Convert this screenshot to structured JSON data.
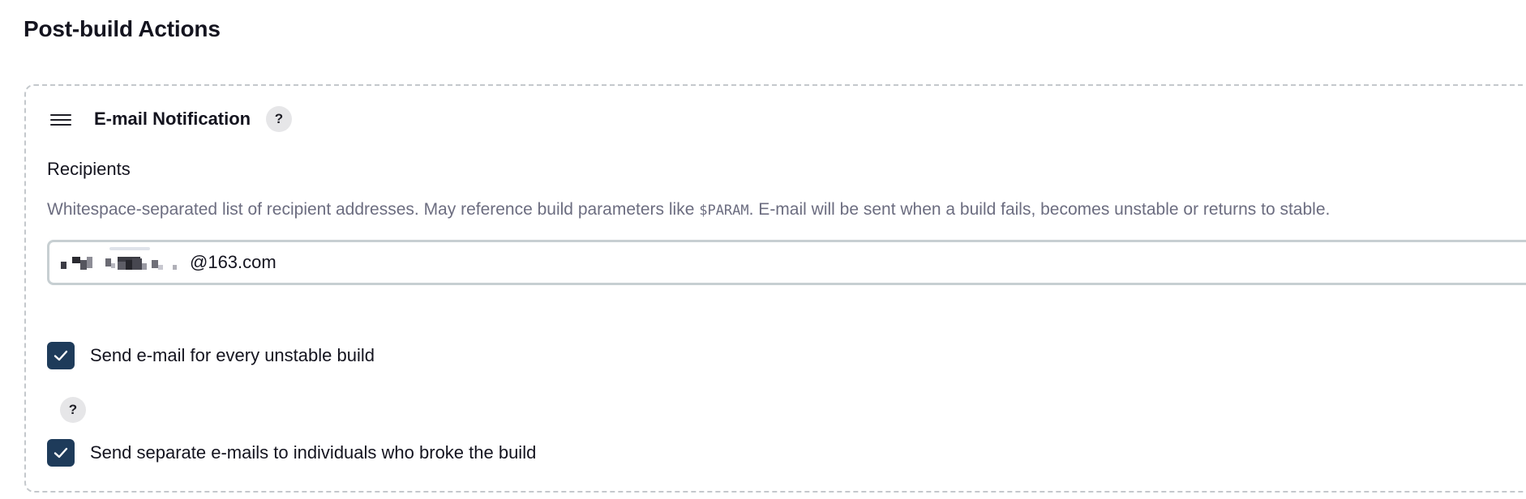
{
  "section": {
    "title": "Post-build Actions"
  },
  "publisher": {
    "title": "E-mail Notification",
    "help_glyph": "?",
    "drag_handle_icon": "hamburger-menu-icon",
    "recipients": {
      "label": "Recipients",
      "description_before": "Whitespace-separated list of recipient addresses. May reference build parameters like ",
      "description_code": "$PARAM",
      "description_after": ". E-mail will be sent when a build fails, becomes unstable or returns to stable.",
      "value": "@163.com",
      "value_redacted": true
    },
    "options": [
      {
        "label": "Send e-mail for every unstable build",
        "checked": true
      },
      {
        "label": "Send separate e-mails to individuals who broke the build",
        "checked": true
      }
    ],
    "option_help_glyph": "?"
  },
  "colors": {
    "checkbox_fill": "#1e3b5a",
    "description_text": "#6c6d80",
    "help_background": "#e6e6e8",
    "card_border": "#c4c8cc"
  }
}
